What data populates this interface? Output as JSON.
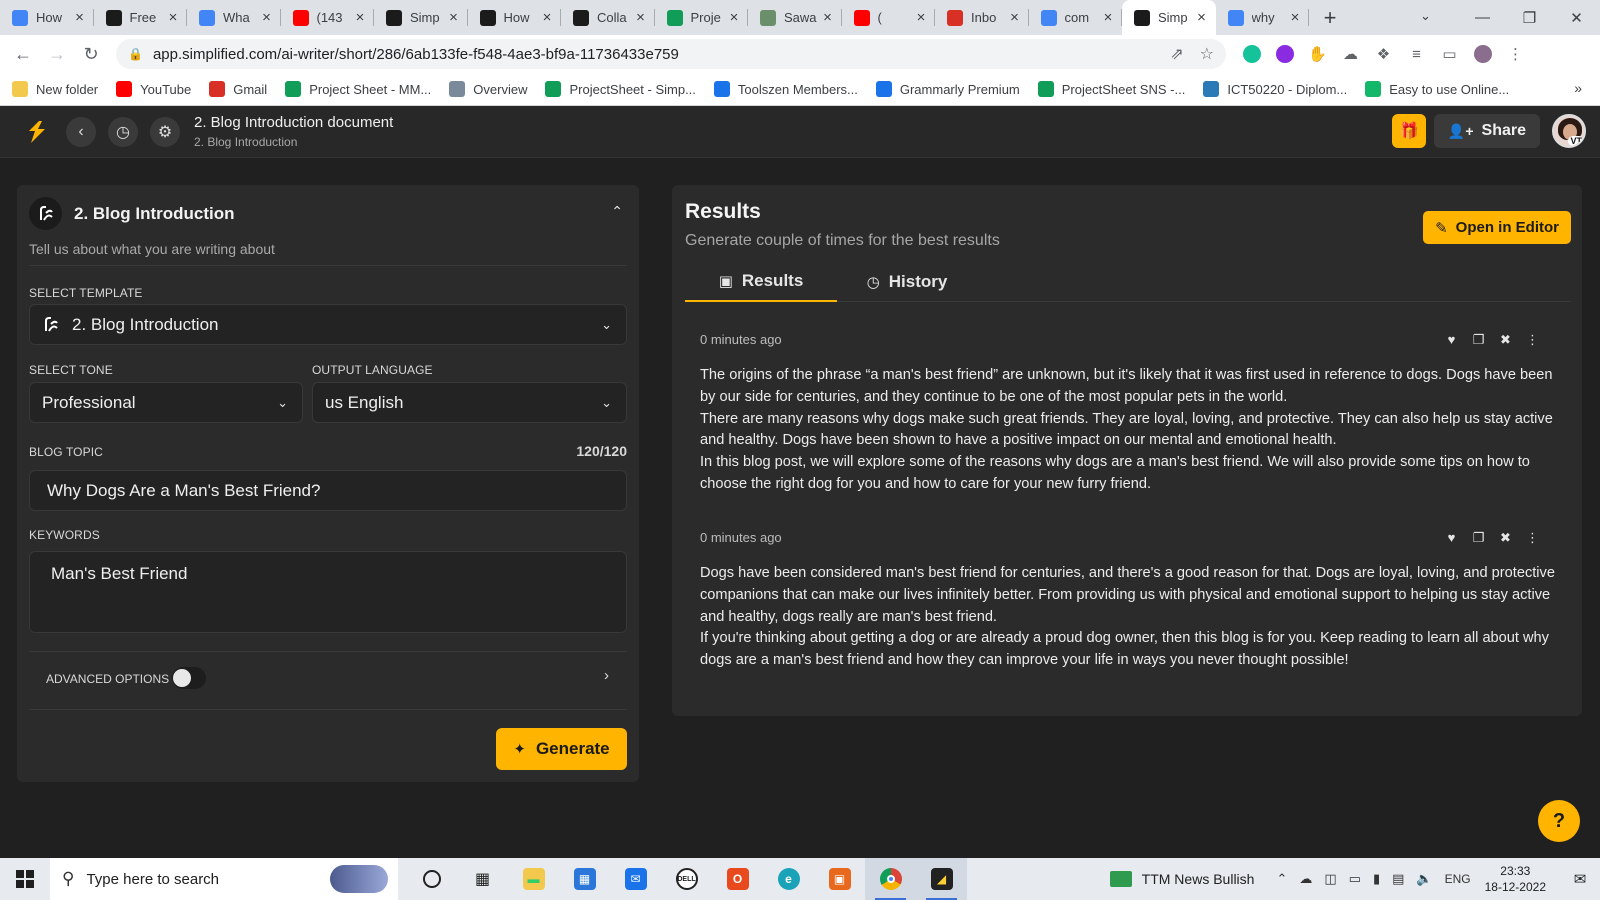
{
  "browser": {
    "tabs": [
      {
        "title": "How",
        "icon": "google-docs-icon",
        "color": "#4285f4",
        "active": false
      },
      {
        "title": "Free",
        "icon": "simplified-icon",
        "color": "#1b1b1b",
        "active": false
      },
      {
        "title": "Wha",
        "icon": "google-docs-icon",
        "color": "#4285f4",
        "active": false
      },
      {
        "title": "(143",
        "icon": "youtube-icon",
        "color": "#ff0000",
        "active": false
      },
      {
        "title": "Simp",
        "icon": "simplified-icon",
        "color": "#1b1b1b",
        "active": false
      },
      {
        "title": "How",
        "icon": "simplified-icon",
        "color": "#1b1b1b",
        "active": false
      },
      {
        "title": "Colla",
        "icon": "simplified-icon",
        "color": "#1b1b1b",
        "active": false
      },
      {
        "title": "Proje",
        "icon": "google-sheets-icon",
        "color": "#0f9d58",
        "active": false
      },
      {
        "title": "Sawa",
        "icon": "sawa-icon",
        "color": "#6b8e6b",
        "active": false
      },
      {
        "title": "(",
        "icon": "youtube-icon",
        "color": "#ff0000",
        "active": false
      },
      {
        "title": "Inbo",
        "icon": "gmail-icon",
        "color": "#d93025",
        "active": false
      },
      {
        "title": "com",
        "icon": "google-icon",
        "color": "#4285f4",
        "active": false
      },
      {
        "title": "Simp",
        "icon": "simplified-icon",
        "color": "#1b1b1b",
        "active": true
      },
      {
        "title": "why",
        "icon": "google-icon",
        "color": "#4285f4",
        "active": false
      }
    ],
    "url": "app.simplified.com/ai-writer/short/286/6ab133fe-f548-4ae3-bf9a-11736433e759",
    "bookmarks": [
      {
        "label": "New folder",
        "icon": "folder-icon",
        "color": "#f2c94c"
      },
      {
        "label": "YouTube",
        "icon": "youtube-icon",
        "color": "#ff0000"
      },
      {
        "label": "Gmail",
        "icon": "gmail-icon",
        "color": "#d93025"
      },
      {
        "label": "Project Sheet - MM...",
        "icon": "google-sheets-icon",
        "color": "#0f9d58"
      },
      {
        "label": "Overview",
        "icon": "overview-icon",
        "color": "#7a8a9a"
      },
      {
        "label": "ProjectSheet - Simp...",
        "icon": "google-sheets-icon",
        "color": "#0f9d58"
      },
      {
        "label": "Toolszen Members...",
        "icon": "toolszen-icon",
        "color": "#1a73e8"
      },
      {
        "label": "Grammarly Premium",
        "icon": "toolszen-icon",
        "color": "#1a73e8"
      },
      {
        "label": "ProjectSheet SNS -...",
        "icon": "google-sheets-icon",
        "color": "#0f9d58"
      },
      {
        "label": "ICT50220 - Diplom...",
        "icon": "globe-icon",
        "color": "#2a7ab8"
      },
      {
        "label": "Easy to use Online...",
        "icon": "s-icon",
        "color": "#12b76a"
      }
    ]
  },
  "app": {
    "doc_title": "2. Blog Introduction document",
    "doc_subtitle": "2. Blog Introduction",
    "share_label": "Share",
    "avatar_initials": "VT",
    "accent": "#ffb400"
  },
  "form": {
    "header_title": "2. Blog Introduction",
    "header_subtitle": "Tell us about what you are writing about",
    "template_label": "SELECT TEMPLATE",
    "template_value": "2. Blog Introduction",
    "tone_label": "SELECT TONE",
    "tone_value": "Professional",
    "language_label": "OUTPUT LANGUAGE",
    "language_value": "us English",
    "topic_label": "BLOG TOPIC",
    "topic_counter": "120/120",
    "topic_value": "Why Dogs Are a Man's Best Friend?",
    "keywords_label": "KEYWORDS",
    "keywords_value": "Man's Best Friend",
    "advanced_label": "ADVANCED OPTIONS",
    "advanced_enabled": false,
    "generate_label": "Generate"
  },
  "results": {
    "title": "Results",
    "subtitle": "Generate couple of times for the best results",
    "open_editor_label": "Open in Editor",
    "tabs": [
      {
        "label": "Results",
        "icon": "robot-icon",
        "active": true
      },
      {
        "label": "History",
        "icon": "clock-icon",
        "active": false
      }
    ],
    "items": [
      {
        "time": "0 minutes ago",
        "paragraphs": [
          "The origins of the phrase “a man's best friend” are unknown, but it's likely that it was first used in reference to dogs. Dogs have been by our side for centuries, and they continue to be one of the most popular pets in the world.",
          "There are many reasons why dogs make such great friends. They are loyal, loving, and protective. They can also help us stay active and healthy. Dogs have been shown to have a positive impact on our mental and emotional health.",
          "In this blog post, we will explore some of the reasons why dogs are a man's best friend. We will also provide some tips on how to choose the right dog for you and how to care for your new furry friend."
        ]
      },
      {
        "time": "0 minutes ago",
        "paragraphs": [
          "Dogs have been considered man's best friend for centuries, and there's a good reason for that. Dogs are loyal, loving, and protective companions that can make our lives infinitely better. From providing us with physical and emotional support to helping us stay active and healthy, dogs really are man's best friend.",
          "If you're thinking about getting a dog or are already a proud dog owner, then this blog is for you. Keep reading to learn all about why dogs are a man's best friend and how they can improve your life in ways you never thought possible!"
        ]
      }
    ]
  },
  "taskbar": {
    "search_placeholder": "Type here to search",
    "news_label": "TTM  News Bullish",
    "language": "ENG",
    "time": "23:33",
    "date": "18-12-2022"
  }
}
